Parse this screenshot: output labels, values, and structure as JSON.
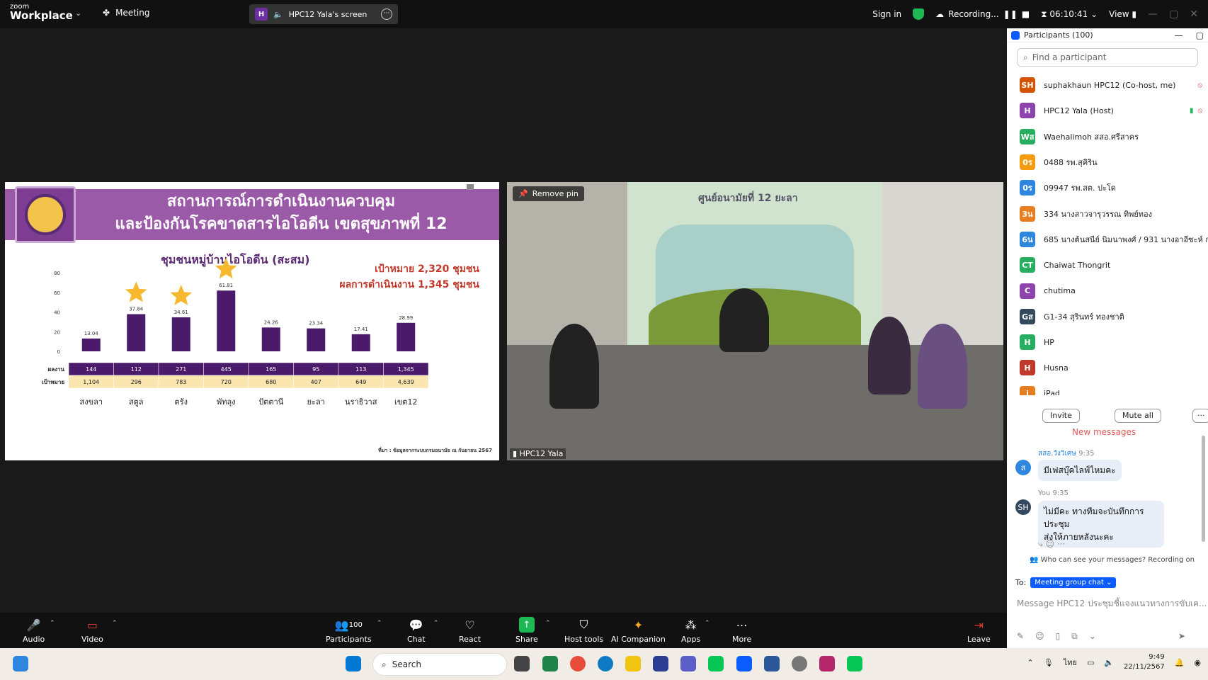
{
  "topbar": {
    "logo_zoom": "zoom",
    "logo_product": "Workplace",
    "meeting_label": "Meeting",
    "share_initial": "H",
    "share_label": "HPC12 Yala's screen",
    "sign_in": "Sign in",
    "recording": "Recording...",
    "timer": "06:10:41",
    "view": "View"
  },
  "slide": {
    "title_line1": "สถานการณ์การดำเนินงานควบคุม",
    "title_line2": "และป้องกันโรคขาดสารไอโอดีน เขตสุขภาพที่ 12",
    "subtitle": "ชุมชนหมู่บ้านไอโอดีน (สะสม)",
    "target_line": "เป้าหมาย 2,320 ชุมชน",
    "result_line": "ผลการดำเนินงาน 1,345 ชุมชน",
    "source": "ที่มา : ข้อมูลจากระบบกรมอนามัย ณ กันยายน 2567"
  },
  "chart_data": {
    "type": "bar",
    "categories": [
      "สงขลา",
      "สตูล",
      "ตรัง",
      "พัทลุง",
      "ปัตตานี",
      "ยะลา",
      "นราธิวาส",
      "เขต12"
    ],
    "values": [
      13.04,
      37.84,
      34.61,
      61.81,
      24.26,
      23.34,
      17.41,
      28.99
    ],
    "ylim": [
      0,
      80
    ],
    "yticks": [
      0,
      20,
      40,
      60,
      80
    ],
    "stars": [
      false,
      true,
      true,
      true,
      false,
      false,
      false,
      false
    ],
    "bar_color": "#4b1a6b",
    "table": {
      "row1_label": "ผลงาน",
      "row1": [
        "144",
        "112",
        "271",
        "445",
        "165",
        "95",
        "113",
        "1,345"
      ],
      "row2_label": "เป้าหมาย",
      "row2": [
        "1,104",
        "296",
        "783",
        "720",
        "680",
        "407",
        "649",
        "4,639"
      ]
    }
  },
  "video": {
    "remove_pin": "Remove pin",
    "name": "HPC12 Yala",
    "wall_title": "ศูนย์อนามัยที่ 12 ยะลา"
  },
  "participants": {
    "title": "Participants (100)",
    "search_placeholder": "Find a participant",
    "list": [
      {
        "initials": "SH",
        "name": "suphakhaun HPC12 (Co-host, me)",
        "color": "#d35400"
      },
      {
        "initials": "H",
        "name": "HPC12 Yala (Host)",
        "color": "#8e44ad"
      },
      {
        "initials": "Wส",
        "name": "Waehalimoh สสอ.ศรีสาคร",
        "color": "#27ae60"
      },
      {
        "initials": "0ร",
        "name": "0488 รพ.สุคิริน",
        "color": "#f39c12"
      },
      {
        "initials": "0ร",
        "name": "09947 รพ.สต. ปะโด",
        "color": "#2e86de"
      },
      {
        "initials": "3น",
        "name": "334 นางสาวจารุวรรณ ทิพย์ทอง",
        "color": "#e67e22"
      },
      {
        "initials": "6น",
        "name": "685 นางต้นสนีย์ นิมนาพงศ์ / 931 นางอาอีซะห์ ก",
        "color": "#2e86de"
      },
      {
        "initials": "CT",
        "name": "Chaiwat Thongrit",
        "color": "#27ae60"
      },
      {
        "initials": "C",
        "name": "chutima",
        "color": "#8e44ad"
      },
      {
        "initials": "Gส",
        "name": "G1-34 สุรินทร์ ทองชาติ",
        "color": "#34495e"
      },
      {
        "initials": "H",
        "name": "HP",
        "color": "#27ae60"
      },
      {
        "initials": "H",
        "name": "Husna",
        "color": "#c0392b"
      },
      {
        "initials": "i",
        "name": "iPad",
        "color": "#e67e22"
      }
    ],
    "invite": "Invite",
    "mute_all": "Mute all"
  },
  "chat": {
    "new_messages": "New messages",
    "msg1_sender": "สสอ.วังวิเศษ",
    "msg1_time": "9:35",
    "msg1_initial": "ส",
    "msg1_text": "มีเฟสบุ๊คไลฟ์ไหมคะ",
    "msg2_sender": "You",
    "msg2_time": "9:35",
    "msg2_initial": "SH",
    "msg2_text_line1": "ไม่มีคะ ทางทีมจะบันทึกการประชุม",
    "msg2_text_line2": "ส่งให้ภายหลังนะคะ",
    "who_can_see": "Who can see your messages? Recording on",
    "to_label": "To:",
    "to_chip": "Meeting group chat",
    "input_placeholder": "Message HPC12 ประชุมชี้แจงแนวทางการขับเค..."
  },
  "toolbar": {
    "audio": "Audio",
    "video": "Video",
    "participants": "Participants",
    "participants_count": "100",
    "chat": "Chat",
    "react": "React",
    "share": "Share",
    "host_tools": "Host tools",
    "ai_companion": "AI Companion",
    "apps": "Apps",
    "more": "More",
    "leave": "Leave"
  },
  "taskbar": {
    "search": "Search",
    "lang": "ไทย",
    "time": "9:49",
    "date": "22/11/2567"
  }
}
